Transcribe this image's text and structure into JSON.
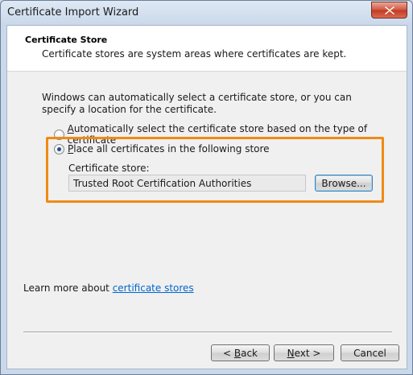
{
  "window": {
    "title": "Certificate Import Wizard"
  },
  "header": {
    "title": "Certificate Store",
    "subtitle": "Certificate stores are system areas where certificates are kept."
  },
  "body": {
    "description": "Windows can automatically select a certificate store, or you can specify a location for the certificate.",
    "option_auto": {
      "accel": "A",
      "rest": "utomatically select the certificate store based on the type of certificate",
      "selected": false
    },
    "option_place": {
      "accel": "P",
      "rest": "lace all certificates in the following store",
      "selected": true
    },
    "store_label": "Certificate store:",
    "store_value": "Trusted Root Certification Authorities",
    "browse_label": "Browse..."
  },
  "learn": {
    "prefix": "Learn more about ",
    "link": "certificate stores"
  },
  "footer": {
    "back": {
      "lt": "< ",
      "accel": "B",
      "rest": "ack"
    },
    "next": {
      "accel": "N",
      "rest": "ext >"
    },
    "cancel": "Cancel"
  },
  "colors": {
    "highlight": "#f08a14",
    "link": "#0066cc",
    "radio_dot": "#24518c"
  }
}
